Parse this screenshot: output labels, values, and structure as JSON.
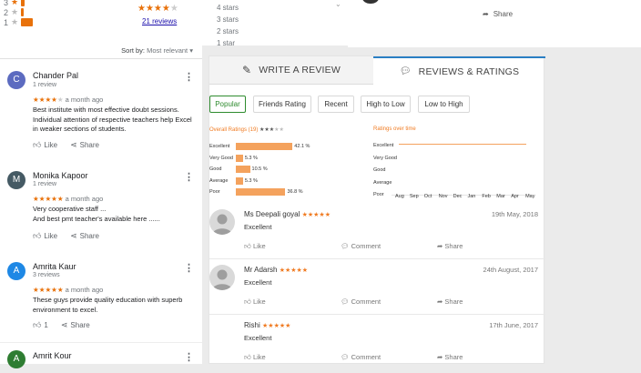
{
  "left": {
    "histogram": [
      {
        "label": "3",
        "width": 4
      },
      {
        "label": "2",
        "width": 3
      },
      {
        "label": "1",
        "width": 13
      }
    ],
    "summary_stars": "★★★★",
    "summary_star_empty": "★",
    "reviews_link": "21 reviews",
    "sort_label": "Sort by:",
    "sort_value": "Most relevant",
    "reviews": [
      {
        "initial": "C",
        "color": "#5c6bc0",
        "name": "Chander Pal",
        "count": "1 review",
        "stars": "★★★★",
        "empty": "★",
        "ago": "a month ago",
        "text": "Best institute with most effective doubt sessions. Individual attention of respective teachers help Excel in weaker sections of students.",
        "like": "Like",
        "share": "Share"
      },
      {
        "initial": "M",
        "color": "#455a64",
        "name": "Monika Kapoor",
        "count": "1 review",
        "stars": "★★★★★",
        "empty": "",
        "ago": "a month ago",
        "text": "Very cooperative staff ...\nAnd best pmt teacher's available here ......",
        "like": "Like",
        "share": "Share"
      },
      {
        "initial": "A",
        "color": "#1e88e5",
        "name": "Amrita Kaur",
        "count": "3 reviews",
        "stars": "★★★★★",
        "empty": "",
        "ago": "a month ago",
        "text": "These guys provide quality education with superb environment to excel.",
        "like": "1",
        "share": "Share"
      },
      {
        "initial": "A",
        "color": "#2e7d32",
        "name": "Amrit Kour",
        "count": "",
        "stars": "",
        "empty": "",
        "ago": "",
        "text": "",
        "like": "",
        "share": ""
      }
    ]
  },
  "midtop": {
    "star_labels": [
      "4 stars",
      "3 stars",
      "2 stars",
      "1 star"
    ]
  },
  "righttop": {
    "share_label": "Share"
  },
  "tabs": {
    "write": "WRITE A REVIEW",
    "ratings": "REVIEWS & RATINGS"
  },
  "filters": [
    "Popular",
    "Friends Rating",
    "Recent",
    "High to Low",
    "Low to High"
  ],
  "overall": {
    "title": "Overall Ratings (19)",
    "stars": "★★★",
    "empty": "★★",
    "rows": [
      {
        "label": "Excellent",
        "pct": "42.1 %",
        "value": 42.1
      },
      {
        "label": "Very Good",
        "pct": "5.3 %",
        "value": 5.3
      },
      {
        "label": "Good",
        "pct": "10.5 %",
        "value": 10.5
      },
      {
        "label": "Average",
        "pct": "5.3 %",
        "value": 5.3
      },
      {
        "label": "Poor",
        "pct": "36.8 %",
        "value": 36.8
      }
    ]
  },
  "overtime": {
    "title": "Ratings over time",
    "levels": [
      "Excellent",
      "Very Good",
      "Good",
      "Average",
      "Poor"
    ],
    "months": [
      "Aug",
      "Sep",
      "Oct",
      "Nov",
      "Dec",
      "Jan",
      "Feb",
      "Mar",
      "Apr",
      "May"
    ]
  },
  "reviews": [
    {
      "name": "Ms Deepali goyal",
      "stars": "★★★★★",
      "date": "19th May, 2018",
      "text": "Excellent",
      "like": "Like",
      "comment": "Comment",
      "share": "Share",
      "has_avatar": true
    },
    {
      "name": "Mr Adarsh",
      "stars": "★★★★★",
      "date": "24th August, 2017",
      "text": "Excellent",
      "like": "Like",
      "comment": "Comment",
      "share": "Share",
      "has_avatar": true
    },
    {
      "name": "Rishi",
      "stars": "★★★★★",
      "date": "17th June, 2017",
      "text": "Excellent",
      "like": "Like",
      "comment": "Comment",
      "share": "Share",
      "has_avatar": false
    }
  ]
}
